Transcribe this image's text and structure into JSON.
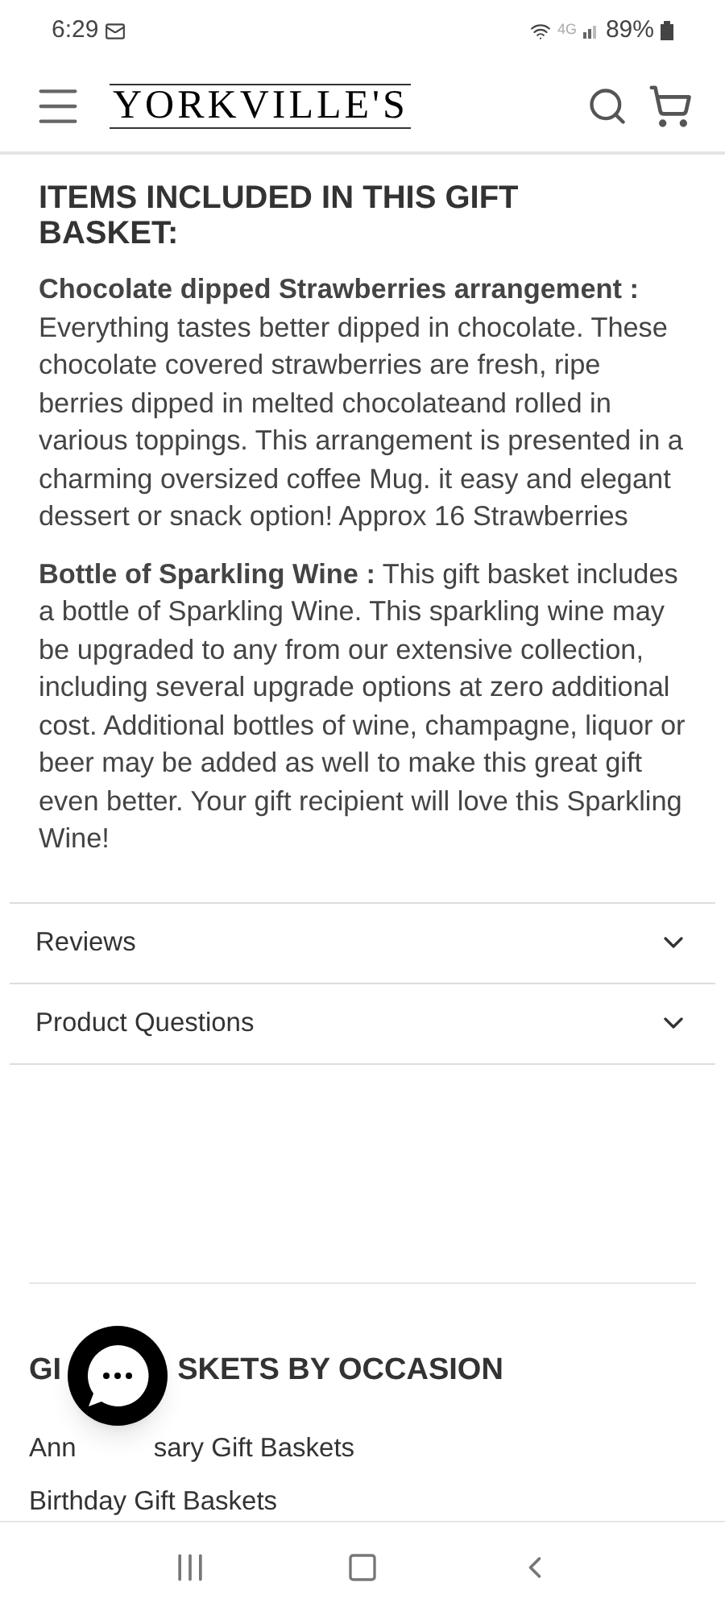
{
  "status_bar": {
    "time": "6:29",
    "network": "4G",
    "battery": "89%"
  },
  "header": {
    "logo": "YORKVILLE'S"
  },
  "section": {
    "title": "ITEMS INCLUDED IN THIS GIFT BASKET:",
    "paragraphs": [
      "**Chocolate dipped Strawberries arrangement :** Everything tastes better dipped in chocolate. These chocolate covered strawberries are fresh, ripe berries dipped in melted chocolateand rolled in various toppings. This arrangement is presented in a charming oversized coffee Mug. it easy and elegant dessert or snack option! Approx 16 Strawberries",
      "**Bottle of Sparkling Wine :** This gift basket includes a bottle of Sparkling Wine. This sparkling wine may be upgraded to any from our extensive collection, including several upgrade options at zero additional cost. Additional bottles of wine, champagne, liquor or beer may be added as well to make this great gift even better. Your gift recipient will love this Sparkling Wine!"
    ]
  },
  "accordions": [
    {
      "label": "Reviews",
      "expanded": false
    },
    {
      "label": "Product Questions",
      "expanded": false
    }
  ],
  "footer": {
    "heading_parts": [
      "GI",
      "SKETS BY OCCASION"
    ],
    "first_link_parts": [
      "Ann",
      "sary Gift Baskets"
    ],
    "links": [
      "Birthday Gift Baskets"
    ]
  }
}
